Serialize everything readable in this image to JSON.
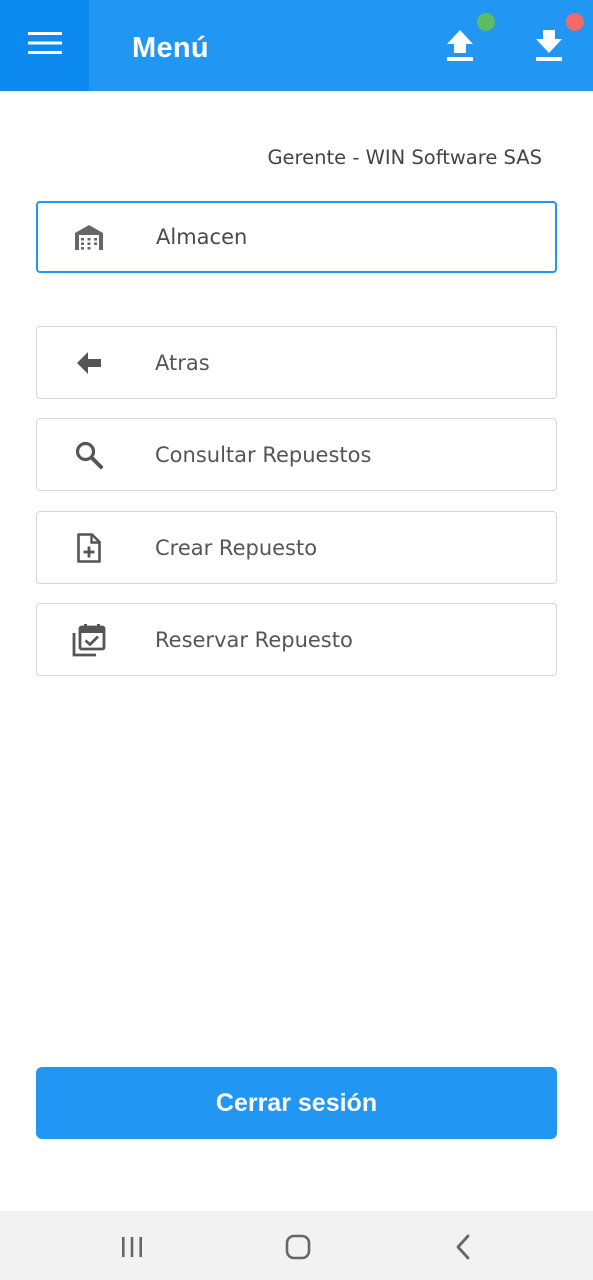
{
  "appbar": {
    "title": "Menú",
    "menu_icon": "hamburger-menu-icon",
    "upload_icon": "upload-icon",
    "download_icon": "download-icon",
    "upload_status_color": "#5DBB63",
    "download_status_color": "#F06A6A",
    "background": "#2196F3"
  },
  "user": {
    "label": "Gerente - WIN Software SAS"
  },
  "module": {
    "label": "Almacen",
    "icon": "warehouse-icon"
  },
  "menu_items": [
    {
      "label": "Atras",
      "icon": "arrow-back-icon"
    },
    {
      "label": "Consultar Repuestos",
      "icon": "search-icon"
    },
    {
      "label": "Crear Repuesto",
      "icon": "add-document-icon"
    },
    {
      "label": "Reservar Repuesto",
      "icon": "calendar-check-icon"
    }
  ],
  "logout": {
    "label": "Cerrar sesión"
  },
  "system_nav": {
    "recents_icon": "recents-icon",
    "home_icon": "home-icon",
    "back_icon": "back-chevron-icon"
  }
}
